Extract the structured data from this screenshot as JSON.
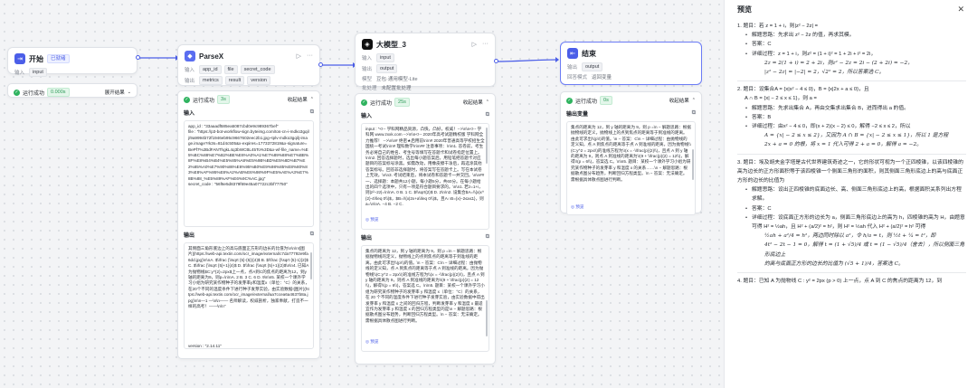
{
  "start_node": {
    "title": "开始",
    "tag": "已就绪",
    "input_label": "输入",
    "input_var": "input",
    "status": "运行成功",
    "time": "0.000s",
    "expand": "展开结果"
  },
  "parse_node": {
    "title": "ParseX",
    "input_label": "输入",
    "output_label": "输出",
    "inputs": [
      "app_id",
      "file",
      "secret_code"
    ],
    "outputs": [
      "metrics",
      "result",
      "version"
    ],
    "status": "运行成功",
    "time": "3s",
    "collapse": "收起结果",
    "sec_input": "输入",
    "sec_output": "输出",
    "input_json": "app_id : \"33aaadf585ea5087cbd0e9c989367bef\"\nfile : \"https://p3-bot-workflow-sign.byteimg.com/tos-cn-i-mdko3gqilj/9a9994b72f1946eb95c9667602eec2b1.jpg~tplv-mdko3gqilj-image.image?rk3s=81d4c505&x-expires=1773372819&x-signature=BePf7%2BdFANThgkL4q3bWCBL45To%3D&x-wf-file_name=%E5%BC%88%E7%B2%BE%E6%A0%A1%E7%89%88%E7%BB%8F%E8%B4%B4%E5%85%A8%E5%9B%BD%E5%8D%B7%E2%85%A0%E7%90%86%E6%95%B0%E9%98%85%E8%80%83%E8%AF%95%E8%A2%AB%E6%98%9F%E5%AE%A3%E7%8B%88_%E5%89%AF%E6%9C%AC.jpg\"\nsecret_code : \"56f6e5d8379f69e45a07722c3bf77750\"",
    "output_text": "其侧面三角形底边上的高与底面正方形的边长的比值为\\n\\n\\n![图片](https://web-api.textin.com/ocr_image/external/c7da77792e9fa6dd.jpg)\\n\\nA. $\\\\frac {\\\\sqrt {5}-{5}}{4}$ B. $\\\\frac {\\\\sqrt {5}-1}{2}$ C. $\\\\frac {\\\\sqrt {5}+1}{4}$ D. $\\\\frac {\\\\sqrt {5}+1}{2}$\\n\\n4. 已知A为抛物线$C:y^{2}=2px$上一点，点A到C的焦点的距离为12，到y轴的距离为9，则p=\\n\\nA. 2 B. 3 C. 6 D. 9\\n\\n5. 某校一个课外学习小组为研究某作物种子的发芽率y和温度x（单位：°C）的关系，在20个不同的温度条件下进行种子发芽实验，由实验数据![图片](https://web-api.textin.com/ocr_image/external/aa7ccea6a4637b8a.jpg)\\n\\n—1 —\\n\\n—— 名师解读，权威剖析，独家奉献，打造不一样的高考！——\\n\\n\"",
    "version_label": "version",
    "version_value": "\"2.14.11\""
  },
  "llm_node": {
    "title": "大模型_3",
    "input_label": "输入",
    "input_var": "input",
    "output_label": "输出",
    "output_var": "output",
    "model_label": "模型",
    "model_value": "豆包·通用模型-Lite",
    "batch_label": "批处理",
    "batch_value": "未配置批处理",
    "status": "运行成功",
    "time": "25s",
    "collapse": "收起结果",
    "sec_input": "输入",
    "sec_output": "输出",
    "preview": "预览",
    "input_text": "input : \"<!-- 学科网精品资源，凸快，凸好，权威！-->\\n\\n<!-- 学科网 www.zxxk.com -->\\n\\n<!-- 2020年高考试题精校版 学科网全力推荐！ -->\\n\\n# 绝密★启用前\\n\\n# 2020年普通高等学校招生全国统一考试\\n\\n# 理科数学\\n\\n## 注意事项：\\n\\n1. 答卷前，考生务必将自己的姓名、考生号等填写在答题卡和试卷指定位置上。\\n\\n2. 回答选择题时，选出每小题答案后，用铅笔把答题卡对应题目的答案标号涂黑。如需改动，用橡皮擦干净后，再选涂其他答案标号。回答非选择题时，将答案写在答题卡上。写在本试卷上无效。\\n\\n3. 考试结束后，将本试卷和答题卡一并交回。\\n\\n## 一、选择题：本题共12小题，每小题5分，共60分。在每小题给出的四个选项中，只有一项是符合题目要求的。\\n\\n1. 若z=1+i，则|z²−2z|=\\n\\nA. 0 B. 1 C. $\\\\sqrt{2}$ D. 2\\n\\n2. 设集合$A=\\\\{x|x^{2}-4\\\\leq 0\\\\}$，$B=\\\\{x|2x+a\\\\leq 0\\\\}$，且A∩B={x|−2≤x≤1}，则a=\\n\\nA. −4 B. −2 C.",
    "output_text": "集点的距离为 12，到 y 轴的距离为 9，则 p =\\n  − 解题思路：根据抛物线的定义，抛物线上的点到焦点的距离等于到准线的距离。由此可求出\\\\(p\\\\)的值。\\n  − 答案：C\\n  − 详细过程：由抛物线的定义知，点 A 到焦点的距离等于点 A 到准线的距离，因为抛物线\\\\(C:y^2 = 2px\\\\)的准线方程为\\\\(x = -\\\\frac{p}{2}\\\\)，且点 A 到 y 轴的距离为 9，则点 A 到准线的距离为\\\\(9 + \\\\frac{p}{2} = 12\\\\)，解得\\\\(p = 6\\\\)，答案选 C。\\n\\n5. 题目：某校一个课外学习小组为研究某作物种子的发芽率 y 和温度 x（单位：°C）的关系，在 20 个不同的温度条件下进行种子发芽实验，由实验数据中得出发芽率 y 和温度 x 之间的回归方程，判断发芽率 y 和温度 x 最适宜作为发芽率 y 和温度 x 的回归方程类型的是\\n  − 解题思路：根据散点图分布趋势，判断回归方程类型。\\n  − 答案：无法确定。需根据具体散点图进行判断。"
  },
  "end_node": {
    "title": "结束",
    "output_label": "输出",
    "output_var": "output",
    "answer_label": "回答模式",
    "answer_value": "返回变量",
    "status": "运行成功",
    "time": "0s",
    "collapse": "收起结果",
    "sec_output": "输出变量",
    "output_text": "集点的距离为 12，到 y 轴的距离为 9，则 p =\\n  − 解题思路：根据抛物线的定义，抛物线上的点到焦点的距离等于到准线的距离。由此可求出\\\\(p\\\\)的值。\\n  − 答案：C\\n  − 详细过程：由抛物线的定义知，点 A 到焦点的距离等于点 A 到准线的距离，因为抛物线\\\\(C:y^2 = 2px\\\\)的准线方程为\\\\(x = -\\\\frac{p}{2}\\\\)，且点 A 到 y 轴的距离为 9，则点 A 到准线的距离为\\\\(9 + \\\\frac{p}{2} = 12\\\\)，解得\\\\(p = 6\\\\)，答案选 C。\\n\\n5. 题目：某校一个课外学习小组为研究某作物种子的发芽率 y 和温度 x 的关系……\\n  − 解题思路：根据散点图分布趋势，判断回归方程类型。\\n  − 答案：无法确定。需根据具体散点图进行判断。",
    "preview": "预览"
  },
  "preview_panel": {
    "title": "预览",
    "q1": "1. 题目：若 z = 1 + i，则|z² − 2z| =",
    "q1_idea": "解题思路：先求出 z² − 2z 的值，再求其模。",
    "q1_answer": "答案：C",
    "q1_detail": "详细过程：z = 1 + i，则z² = (1 + i)² = 1 + 2i + i² = 2i，",
    "q1_m1": "2z = 2(1 + i) = 2 + 2i，则z² − 2z = 2i − (2 + 2i) = −2，",
    "q1_m2": "|z² − 2z| = |−2| = 2，√2² = 2，所以答案选 C。",
    "q2": "2. 题目：设集合A = {x|x² − 4 ≤ 0}，B = {x|2x + a ≤ 0}，且",
    "q2_cond": "A ∩ B = {x| − 2 ≤ x ≤ 1}，则 a =",
    "q2_idea": "解题思路：先求出集合 A，再由交集求出集合 B，进而得出 a 的值。",
    "q2_answer": "答案：B",
    "q2_detail": "详细过程：由x² − 4 ≤ 0，即(x + 2)(x − 2) ≤ 0，解得 −2 ≤ x ≤ 2，所以",
    "q2_m1": "A = {x| − 2 ≤ x ≤ 2}，又因为 A ∩ B = {x| − 2 ≤ x ≤ 1}，所以 1 是方程",
    "q2_m2": "2x + a = 0 的根，将 x = 1 代入可得 2 + a = 0，解得 a = −2。",
    "q3": "3. 题目：埃及胡夫金字塔是古代世界建筑奇迹之一，它的形状可视为一个正四棱锥，以该四棱锥的高为边长的正方形面积等于该四棱锥一个侧面三角形的面积，则其侧面三角形底边上的高与底面正方形的边长的比值为",
    "q3_idea": "解题思路：设出正四棱锥的底面边长、高、侧面三角形底边上的高，根据面积关系列出方程求解。",
    "q3_answer": "答案：C",
    "q3_detail": "详细过程：设底面正方形的边长为 a，侧面三角形底边上的高为 h，四棱锥的高为 H，由题意可得 H² = ½ah，且 H² + (a/2)² = h²，则 H² = ½ah 代入 H² + (a/2)² = h² 可得",
    "q3_m1": "½ah + a²/4 = h²，两边同时除以 a²，令 h/a = t，则 ½t + ¼ = t²，即",
    "q3_m2": "4t² − 2t − 1 = 0，解得 t = (1 + √5)/4 或 t = (1 − √5)/4（舍去），所以侧面三角形底边上",
    "q3_m3": "的高与底面正方形的边长的比值为 (√5 + 1)/4，答案选 C。",
    "q4": "4. 题目：已知 A 为抛物线 C : y² = 2px (p > 0) 上一点，点 A 到 C 的焦点的距离为 12，到"
  },
  "colors": {
    "accent": "#4b5ee8",
    "success": "#2fb35f",
    "start_icon": "#4b5ee8",
    "parse_icon": "#5a6df0",
    "llm_icon": "#111111",
    "end_icon": "#4b5ee8"
  },
  "icons": {
    "close": "close-icon",
    "more": "more-icon",
    "debug": "debug-icon",
    "check": "check-icon"
  }
}
